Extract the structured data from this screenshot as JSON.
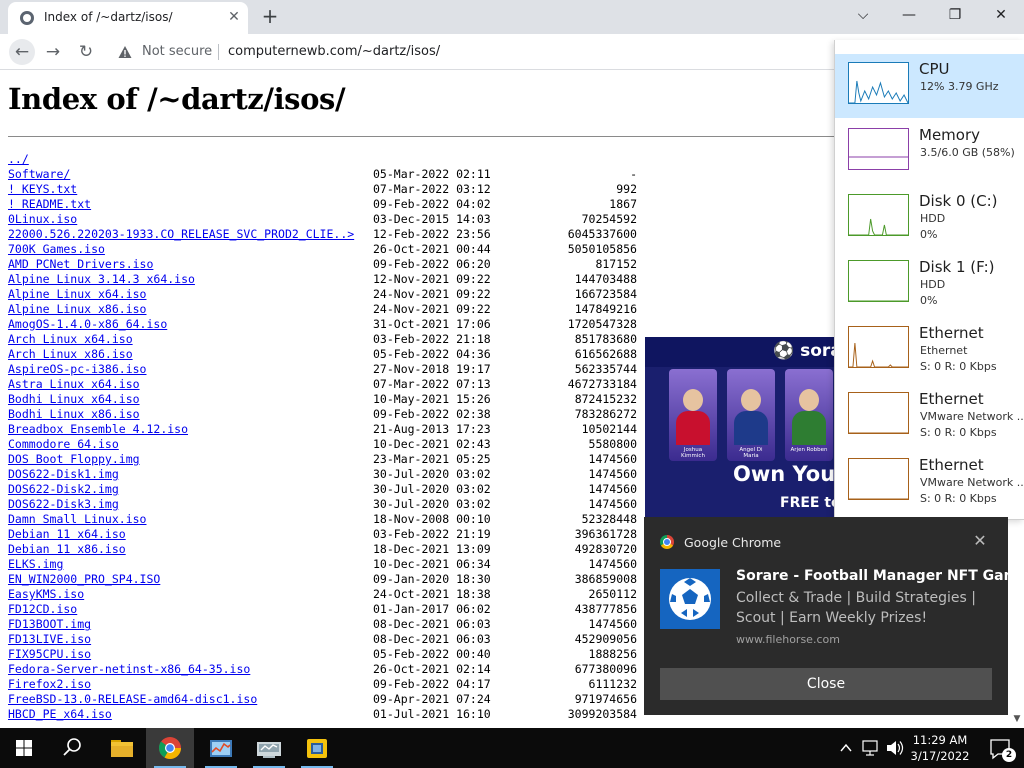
{
  "browser": {
    "tab_title": "Index of /~dartz/isos/",
    "tab_close": "✕",
    "new_tab": "+",
    "window_controls": {
      "tab_search": "⌵",
      "minimize": "—",
      "restore": "❐",
      "close": "✕"
    },
    "nav": {
      "back": "←",
      "forward": "→",
      "reload": "↻"
    },
    "security_label": "Not secure",
    "url": "computernewb.com/~dartz/isos/"
  },
  "page": {
    "heading": "Index of /~dartz/isos/",
    "entries": [
      {
        "name": "../",
        "date": "",
        "size": ""
      },
      {
        "name": "Software/",
        "date": "05-Mar-2022 02:11",
        "size": "-"
      },
      {
        "name": "! KEYS.txt",
        "date": "07-Mar-2022 03:12",
        "size": "992"
      },
      {
        "name": "! README.txt",
        "date": "09-Feb-2022 04:02",
        "size": "1867"
      },
      {
        "name": "0Linux.iso",
        "date": "03-Dec-2015 14:03",
        "size": "70254592"
      },
      {
        "name": "22000.526.220203-1933.CO_RELEASE_SVC_PROD2_CLIE..>",
        "date": "12-Feb-2022 23:56",
        "size": "6045337600"
      },
      {
        "name": "700K Games.iso",
        "date": "26-Oct-2021 00:44",
        "size": "5050105856"
      },
      {
        "name": "AMD PCNet Drivers.iso",
        "date": "09-Feb-2022 06:20",
        "size": "817152"
      },
      {
        "name": "Alpine Linux 3.14.3 x64.iso",
        "date": "12-Nov-2021 09:22",
        "size": "144703488"
      },
      {
        "name": "Alpine Linux x64.iso",
        "date": "24-Nov-2021 09:22",
        "size": "166723584"
      },
      {
        "name": "Alpine Linux x86.iso",
        "date": "24-Nov-2021 09:22",
        "size": "147849216"
      },
      {
        "name": "AmogOS-1.4.0-x86_64.iso",
        "date": "31-Oct-2021 17:06",
        "size": "1720547328"
      },
      {
        "name": "Arch Linux x64.iso",
        "date": "03-Feb-2022 21:18",
        "size": "851783680"
      },
      {
        "name": "Arch Linux x86.iso",
        "date": "05-Feb-2022 04:36",
        "size": "616562688"
      },
      {
        "name": "AspireOS-pc-i386.iso",
        "date": "27-Nov-2018 19:17",
        "size": "562335744"
      },
      {
        "name": "Astra Linux x64.iso",
        "date": "07-Mar-2022 07:13",
        "size": "4672733184"
      },
      {
        "name": "Bodhi Linux x64.iso",
        "date": "10-May-2021 15:26",
        "size": "872415232"
      },
      {
        "name": "Bodhi Linux x86.iso",
        "date": "09-Feb-2022 02:38",
        "size": "783286272"
      },
      {
        "name": "Breadbox Ensemble 4.12.iso",
        "date": "21-Aug-2013 17:23",
        "size": "10502144"
      },
      {
        "name": "Commodore 64.iso",
        "date": "10-Dec-2021 02:43",
        "size": "5580800"
      },
      {
        "name": "DOS Boot Floppy.img",
        "date": "23-Mar-2021 05:25",
        "size": "1474560"
      },
      {
        "name": "DOS622-Disk1.img",
        "date": "30-Jul-2020 03:02",
        "size": "1474560"
      },
      {
        "name": "DOS622-Disk2.img",
        "date": "30-Jul-2020 03:02",
        "size": "1474560"
      },
      {
        "name": "DOS622-Disk3.img",
        "date": "30-Jul-2020 03:02",
        "size": "1474560"
      },
      {
        "name": "Damn Small Linux.iso",
        "date": "18-Nov-2008 00:10",
        "size": "52328448"
      },
      {
        "name": "Debian 11 x64.iso",
        "date": "03-Feb-2022 21:19",
        "size": "396361728"
      },
      {
        "name": "Debian 11 x86.iso",
        "date": "18-Dec-2021 13:09",
        "size": "492830720"
      },
      {
        "name": "ELKS.img",
        "date": "10-Dec-2021 06:34",
        "size": "1474560"
      },
      {
        "name": "EN_WIN2000_PRO_SP4.ISO",
        "date": "09-Jan-2020 18:30",
        "size": "386859008"
      },
      {
        "name": "EasyKMS.iso",
        "date": "24-Oct-2021 18:38",
        "size": "2650112"
      },
      {
        "name": "FD12CD.iso",
        "date": "01-Jan-2017 06:02",
        "size": "438777856"
      },
      {
        "name": "FD13BOOT.img",
        "date": "08-Dec-2021 06:03",
        "size": "1474560"
      },
      {
        "name": "FD13LIVE.iso",
        "date": "08-Dec-2021 06:03",
        "size": "452909056"
      },
      {
        "name": "FIX95CPU.iso",
        "date": "05-Feb-2022 00:40",
        "size": "1888256"
      },
      {
        "name": "Fedora-Server-netinst-x86_64-35.iso",
        "date": "26-Oct-2021 02:14",
        "size": "677380096"
      },
      {
        "name": "Firefox2.iso",
        "date": "09-Feb-2022 04:17",
        "size": "6111232"
      },
      {
        "name": "FreeBSD-13.0-RELEASE-amd64-disc1.iso",
        "date": "09-Apr-2021 07:24",
        "size": "971974656"
      },
      {
        "name": "HBCD_PE_x64.iso",
        "date": "01-Jul-2021 16:10",
        "size": "3099203584"
      }
    ]
  },
  "ad": {
    "brand": "⚽ sorare",
    "headline": "Own You",
    "subline": "FREE to",
    "cards": [
      {
        "label": "Joshua Kimmich",
        "color": "#c8102e"
      },
      {
        "label": "Angel Di Maria",
        "color": "#1e3a8a"
      },
      {
        "label": "Arjen Robben",
        "color": "#2e7d32"
      }
    ]
  },
  "task_manager": {
    "items": [
      {
        "title": "CPU",
        "line1": "12% 3.79 GHz",
        "line2": "",
        "color": "#1a7bb8",
        "selected": true
      },
      {
        "title": "Memory",
        "line1": "3.5/6.0 GB (58%)",
        "line2": "",
        "color": "#8b3fa8",
        "selected": false
      },
      {
        "title": "Disk 0 (C:)",
        "line1": "HDD",
        "line2": "0%",
        "color": "#4c9a2a",
        "selected": false
      },
      {
        "title": "Disk 1 (F:)",
        "line1": "HDD",
        "line2": "0%",
        "color": "#4c9a2a",
        "selected": false
      },
      {
        "title": "Ethernet",
        "line1": "Ethernet",
        "line2": "S: 0 R: 0 Kbps",
        "color": "#a7611a",
        "selected": false
      },
      {
        "title": "Ethernet",
        "line1": "VMware Network ...",
        "line2": "S: 0 R: 0 Kbps",
        "color": "#a7611a",
        "selected": false
      },
      {
        "title": "Ethernet",
        "line1": "VMware Network ...",
        "line2": "S: 0 R: 0 Kbps",
        "color": "#a7611a",
        "selected": false
      }
    ]
  },
  "notification": {
    "app": "Google Chrome",
    "dismiss": "✕",
    "title": "Sorare - Football Manager NFT Game",
    "body": "Collect & Trade | Build Strategies | Scout | Earn Weekly Prizes!",
    "source": "www.filehorse.com",
    "close_label": "Close"
  },
  "scrollbar": {
    "down_arrow": "▼"
  },
  "taskbar": {
    "apps": [
      {
        "name": "file-explorer",
        "active": false,
        "running": false
      },
      {
        "name": "chrome",
        "active": true,
        "running": true
      },
      {
        "name": "task-manager",
        "active": false,
        "running": true
      },
      {
        "name": "control-panel",
        "active": false,
        "running": true
      },
      {
        "name": "app-yellow",
        "active": false,
        "running": true
      }
    ],
    "time": "11:29 AM",
    "date": "3/17/2022",
    "notification_count": "2"
  }
}
